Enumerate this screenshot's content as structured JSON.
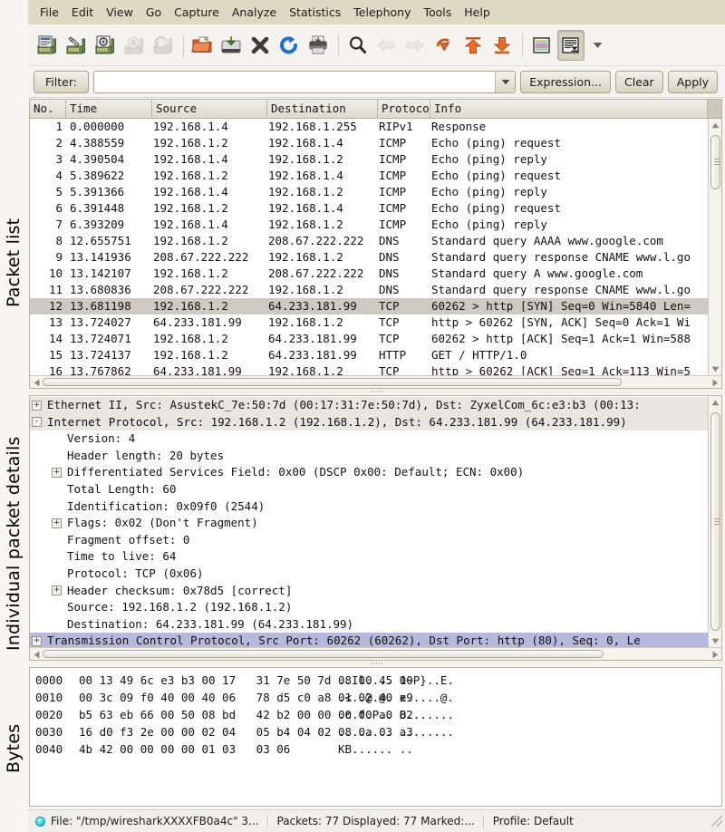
{
  "annotations": {
    "packet_list": "Packet list",
    "packet_details": "Individual packet details",
    "bytes": "Bytes"
  },
  "menubar": {
    "items": [
      {
        "label": "File"
      },
      {
        "label": "Edit"
      },
      {
        "label": "View"
      },
      {
        "label": "Go"
      },
      {
        "label": "Capture"
      },
      {
        "label": "Analyze"
      },
      {
        "label": "Statistics"
      },
      {
        "label": "Telephony"
      },
      {
        "label": "Tools"
      },
      {
        "label": "Help"
      }
    ]
  },
  "toolbar": {
    "buttons": [
      {
        "icon": "list-interfaces-icon",
        "enabled": true
      },
      {
        "icon": "capture-options-icon",
        "enabled": true
      },
      {
        "icon": "start-capture-icon",
        "enabled": true
      },
      {
        "icon": "stop-capture-icon",
        "enabled": false
      },
      {
        "icon": "restart-capture-icon",
        "enabled": false
      },
      {
        "icon": "open-file-icon",
        "enabled": true
      },
      {
        "icon": "save-file-icon",
        "enabled": true
      },
      {
        "icon": "close-file-icon",
        "enabled": true
      },
      {
        "icon": "reload-icon",
        "enabled": true
      },
      {
        "icon": "print-icon",
        "enabled": true
      },
      {
        "icon": "find-packet-icon",
        "enabled": true
      },
      {
        "icon": "go-back-icon",
        "enabled": false
      },
      {
        "icon": "go-forward-icon",
        "enabled": false
      },
      {
        "icon": "go-to-packet-icon",
        "enabled": true
      },
      {
        "icon": "go-to-first-packet-icon",
        "enabled": true
      },
      {
        "icon": "go-to-last-packet-icon",
        "enabled": true
      },
      {
        "icon": "colorize-icon",
        "enabled": true
      },
      {
        "icon": "auto-scroll-icon",
        "enabled": true,
        "pressed": true
      }
    ],
    "overflow_icon": "chevron-down-icon"
  },
  "filterbar": {
    "label": "Filter:",
    "value": "",
    "placeholder": "",
    "dropdown_icon": "chevron-down-icon",
    "expression_label": "Expression...",
    "clear_label": "Clear",
    "apply_label": "Apply"
  },
  "packet_list": {
    "columns": [
      "No.",
      "Time",
      "Source",
      "Destination",
      "Protocol",
      "Info"
    ],
    "selected_row": 12,
    "rows": [
      {
        "no": "1",
        "time": "0.000000",
        "source": "192.168.1.4",
        "destination": "192.168.1.255",
        "protocol": "RIPv1",
        "info": "Response"
      },
      {
        "no": "2",
        "time": "4.388559",
        "source": "192.168.1.2",
        "destination": "192.168.1.4",
        "protocol": "ICMP",
        "info": "Echo (ping) request"
      },
      {
        "no": "3",
        "time": "4.390504",
        "source": "192.168.1.4",
        "destination": "192.168.1.2",
        "protocol": "ICMP",
        "info": "Echo (ping) reply"
      },
      {
        "no": "4",
        "time": "5.389622",
        "source": "192.168.1.2",
        "destination": "192.168.1.4",
        "protocol": "ICMP",
        "info": "Echo (ping) request"
      },
      {
        "no": "5",
        "time": "5.391366",
        "source": "192.168.1.4",
        "destination": "192.168.1.2",
        "protocol": "ICMP",
        "info": "Echo (ping) reply"
      },
      {
        "no": "6",
        "time": "6.391448",
        "source": "192.168.1.2",
        "destination": "192.168.1.4",
        "protocol": "ICMP",
        "info": "Echo (ping) request"
      },
      {
        "no": "7",
        "time": "6.393209",
        "source": "192.168.1.4",
        "destination": "192.168.1.2",
        "protocol": "ICMP",
        "info": "Echo (ping) reply"
      },
      {
        "no": "8",
        "time": "12.655751",
        "source": "192.168.1.2",
        "destination": "208.67.222.222",
        "protocol": "DNS",
        "info": "Standard query AAAA www.google.com"
      },
      {
        "no": "9",
        "time": "13.141936",
        "source": "208.67.222.222",
        "destination": "192.168.1.2",
        "protocol": "DNS",
        "info": "Standard query response CNAME www.l.go"
      },
      {
        "no": "10",
        "time": "13.142107",
        "source": "192.168.1.2",
        "destination": "208.67.222.222",
        "protocol": "DNS",
        "info": "Standard query A www.google.com"
      },
      {
        "no": "11",
        "time": "13.680836",
        "source": "208.67.222.222",
        "destination": "192.168.1.2",
        "protocol": "DNS",
        "info": "Standard query response CNAME www.l.go"
      },
      {
        "no": "12",
        "time": "13.681198",
        "source": "192.168.1.2",
        "destination": "64.233.181.99",
        "protocol": "TCP",
        "info": "60262 > http [SYN] Seq=0 Win=5840 Len="
      },
      {
        "no": "13",
        "time": "13.724027",
        "source": "64.233.181.99",
        "destination": "192.168.1.2",
        "protocol": "TCP",
        "info": "http > 60262 [SYN, ACK] Seq=0 Ack=1 Wi"
      },
      {
        "no": "14",
        "time": "13.724071",
        "source": "192.168.1.2",
        "destination": "64.233.181.99",
        "protocol": "TCP",
        "info": "60262 > http [ACK] Seq=1 Ack=1 Win=588"
      },
      {
        "no": "15",
        "time": "13.724137",
        "source": "192.168.1.2",
        "destination": "64.233.181.99",
        "protocol": "HTTP",
        "info": "GET / HTTP/1.0"
      },
      {
        "no": "16",
        "time": "13.767862",
        "source": "64.233.181.99",
        "destination": "192.168.1.2",
        "protocol": "TCP",
        "info": "http > 60262 [ACK] Seq=1 Ack=113 Win=5"
      }
    ]
  },
  "packet_details": {
    "rows": [
      {
        "indent": 0,
        "expander": "+",
        "highlight": true,
        "text": "Ethernet II, Src: AsustekC_7e:50:7d (00:17:31:7e:50:7d), Dst: ZyxelCom_6c:e3:b3 (00:13:"
      },
      {
        "indent": 0,
        "expander": "-",
        "highlight": true,
        "text": "Internet Protocol, Src: 192.168.1.2 (192.168.1.2), Dst: 64.233.181.99 (64.233.181.99)"
      },
      {
        "indent": 1,
        "expander": "",
        "text": "Version: 4"
      },
      {
        "indent": 1,
        "expander": "",
        "text": "Header length: 20 bytes"
      },
      {
        "indent": 1,
        "expander": "+",
        "text": "Differentiated Services Field: 0x00 (DSCP 0x00: Default; ECN: 0x00)"
      },
      {
        "indent": 1,
        "expander": "",
        "text": "Total Length: 60"
      },
      {
        "indent": 1,
        "expander": "",
        "text": "Identification: 0x09f0 (2544)"
      },
      {
        "indent": 1,
        "expander": "+",
        "text": "Flags: 0x02 (Don't Fragment)"
      },
      {
        "indent": 1,
        "expander": "",
        "text": "Fragment offset: 0"
      },
      {
        "indent": 1,
        "expander": "",
        "text": "Time to live: 64"
      },
      {
        "indent": 1,
        "expander": "",
        "text": "Protocol: TCP (0x06)"
      },
      {
        "indent": 1,
        "expander": "+",
        "text": "Header checksum: 0x78d5 [correct]"
      },
      {
        "indent": 1,
        "expander": "",
        "text": "Source: 192.168.1.2 (192.168.1.2)"
      },
      {
        "indent": 1,
        "expander": "",
        "text": "Destination: 64.233.181.99 (64.233.181.99)"
      },
      {
        "indent": 0,
        "expander": "+",
        "selected": true,
        "text": "Transmission Control Protocol, Src Port: 60262 (60262), Dst Port: http (80), Seq: 0, Le"
      }
    ]
  },
  "packet_bytes": {
    "rows": [
      {
        "offset": "0000",
        "hex": "00 13 49 6c e3 b3 00 17   31 7e 50 7d 08 00 45 00",
        "ascii": "..Il.... 1~P}..E."
      },
      {
        "offset": "0010",
        "hex": "00 3c 09 f0 40 00 40 06   78 d5 c0 a8 01 02 40 e9",
        "ascii": ".<..@.@. x.....@."
      },
      {
        "offset": "0020",
        "hex": "b5 63 eb 66 00 50 08 bd   42 b2 00 00 00 00 a0 02",
        "ascii": ".c.f.P.. B......."
      },
      {
        "offset": "0030",
        "hex": "16 d0 f3 2e 00 00 02 04   05 b4 04 02 08 0a 03 a3",
        "ascii": "........ ........"
      },
      {
        "offset": "0040",
        "hex": "4b 42 00 00 00 00 01 03   03 06",
        "ascii": "KB...... .."
      }
    ]
  },
  "statusbar": {
    "led_icon": "capture-status-led-icon",
    "file_text": "File: \"/tmp/wiresharkXXXXFB0a4c\" 3...",
    "packets_text": "Packets: 77 Displayed: 77 Marked:...",
    "profile_text": "Profile: Default"
  },
  "colors": {
    "menubar_bg": "#ded9c3",
    "toolbar_bg": "#f4f3ef",
    "selected_row": "#cdcac2",
    "selected_detail": "#b8b8dd",
    "led": "#27d6e6"
  }
}
